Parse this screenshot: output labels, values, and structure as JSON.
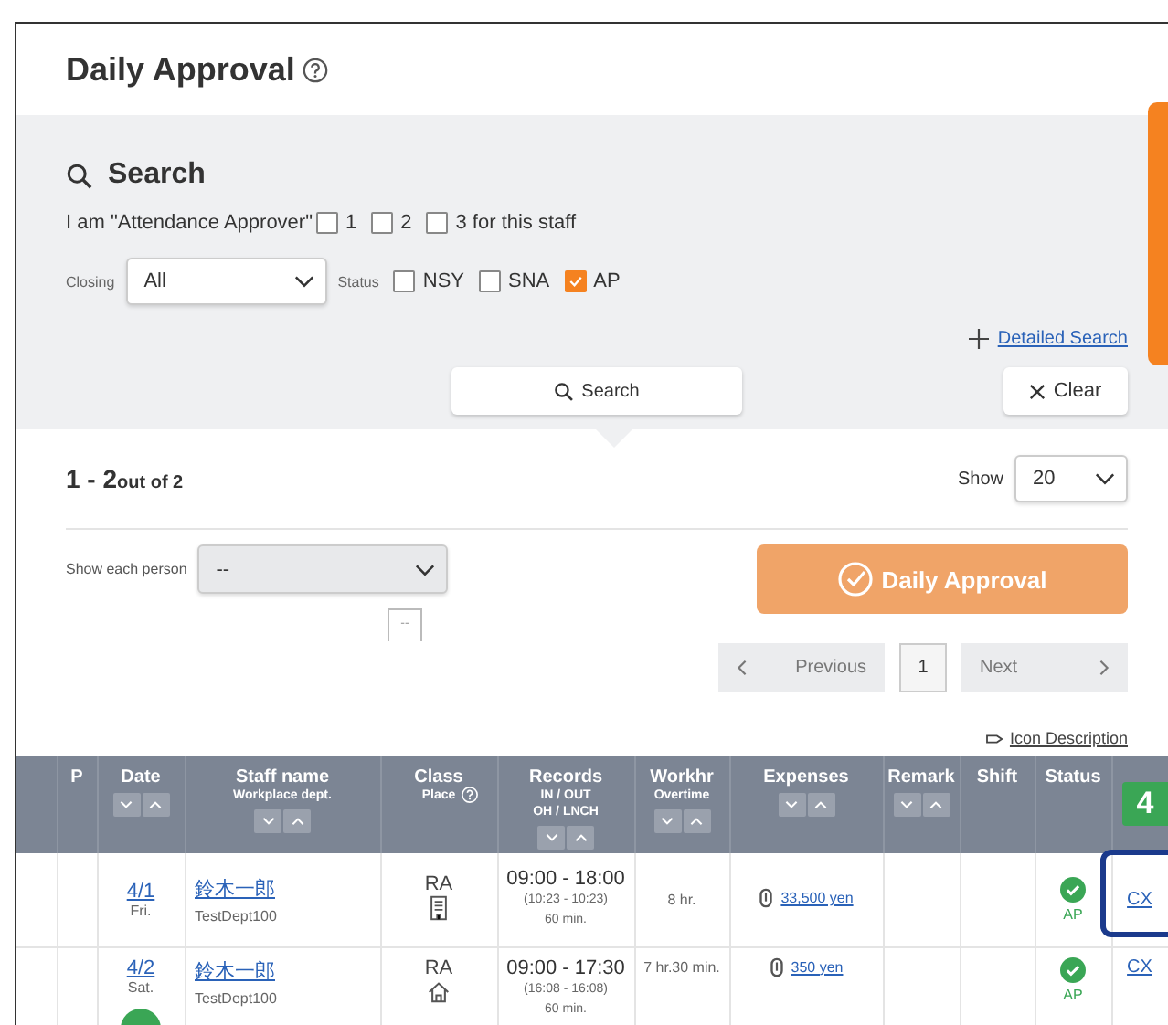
{
  "title": "Daily Approval",
  "search": {
    "heading": "Search",
    "approver_label": "I am \"Attendance Approver\"",
    "approver_options": [
      {
        "label": "1",
        "checked": false
      },
      {
        "label": "2",
        "checked": false
      },
      {
        "label": "3 for this staff",
        "checked": false
      }
    ],
    "closing_label": "Closing",
    "closing_value": "All",
    "status_label": "Status",
    "status_options": [
      {
        "label": "NSY",
        "checked": false
      },
      {
        "label": "SNA",
        "checked": false
      },
      {
        "label": "AP",
        "checked": true
      }
    ],
    "detailed_search": "Detailed Search",
    "search_button": "Search",
    "clear_button": "Clear"
  },
  "results": {
    "range": "1 - 2",
    "range_suffix": "out of 2",
    "show_label": "Show",
    "show_value": "20",
    "person_label": "Show each person",
    "person_value": "--",
    "person_box": "--",
    "approve_button": {
      "label": "Daily Approval",
      "disabled": true
    },
    "pagination": {
      "previous": "Previous",
      "pages": [
        {
          "label": "1",
          "selected": true
        }
      ],
      "next": "Next"
    },
    "icon_description": "Icon Description"
  },
  "table": {
    "columns": [
      {
        "sortable": false,
        "help": false
      },
      {
        "label": "P",
        "sortable": false,
        "help": false
      },
      {
        "label": "Date",
        "sortable": true,
        "help": false
      },
      {
        "label": "Staff name",
        "sub": [
          "Workplace dept."
        ],
        "sortable": true,
        "help": false
      },
      {
        "label": "Class",
        "sub": [
          "Place"
        ],
        "sortable": false,
        "help": true
      },
      {
        "label": "Records",
        "sub": [
          "IN / OUT",
          "OH / LNCH"
        ],
        "sortable": true,
        "help": false
      },
      {
        "label": "Workhr",
        "sub": [
          "Overtime"
        ],
        "sortable": true,
        "help": false
      },
      {
        "label": "Expenses",
        "sortable": true,
        "help": false
      },
      {
        "label": "Remark",
        "sortable": true,
        "help": false
      },
      {
        "label": "Shift",
        "sortable": false,
        "help": false
      },
      {
        "label": "Status",
        "sortable": false,
        "help": false
      },
      {
        "sortable": false,
        "help": false
      }
    ],
    "rows": [
      {
        "date": "4/1",
        "day": "Fri.",
        "name": "鈴木一郎",
        "dept": "TestDept100",
        "class": "RA",
        "place": {
          "kind": "office"
        },
        "records": [
          "09:00 - 18:00",
          "(10:23 - 10:23)",
          "60 min."
        ],
        "workhr": "8 hr.",
        "expense": "33,500 yen",
        "status": "AP",
        "action": "CX"
      },
      {
        "date": "4/2",
        "day": "Sat.",
        "name": "鈴木一郎",
        "dept": "TestDept100",
        "class": "RA",
        "place": {
          "kind": "home"
        },
        "records": [
          "09:00 - 17:30",
          "(16:08 - 16:08)",
          "60 min."
        ],
        "workhr": "7 hr.30 min.",
        "expense": "350 yen",
        "status": "AP",
        "action": "CX"
      }
    ]
  },
  "annotations": [
    {
      "label": "4"
    }
  ]
}
